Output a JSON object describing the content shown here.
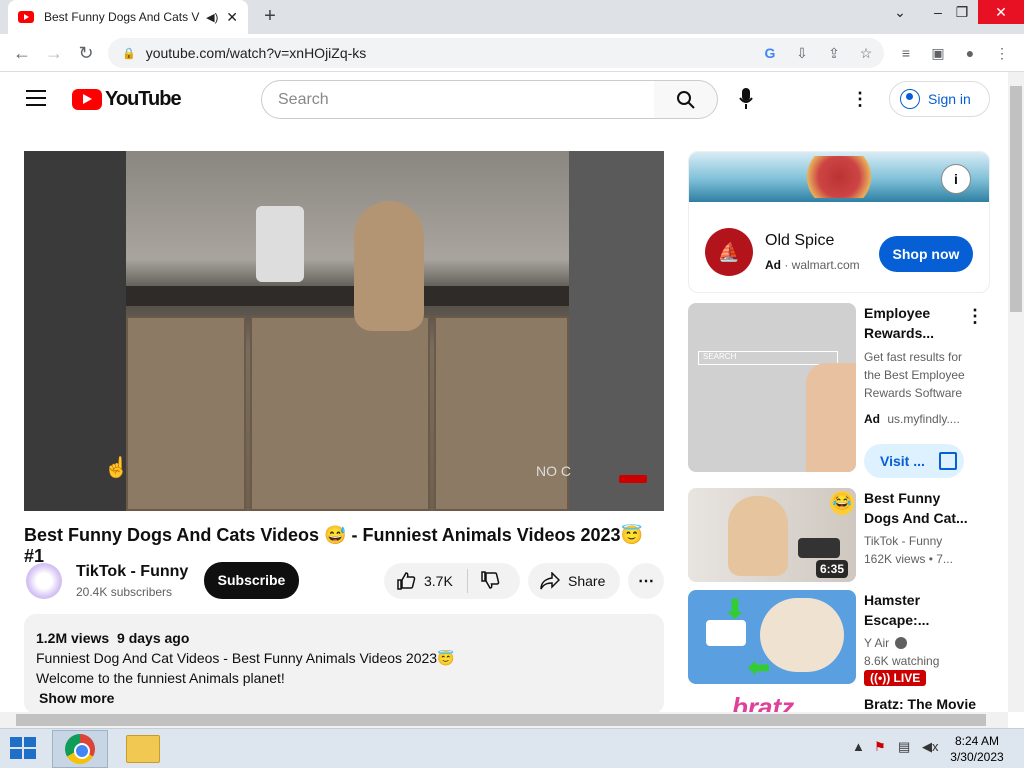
{
  "browser": {
    "tab_title": "Best Funny Dogs And Cats V",
    "new_tab_label": "+",
    "address": "youtube.com/watch?v=xnHOjiZq-ks"
  },
  "youtube": {
    "logo_text": "YouTube",
    "search_placeholder": "Search",
    "signin_label": "Sign in"
  },
  "video": {
    "title": "Best Funny Dogs And Cats Videos 😅 - Funniest Animals Videos 2023😇 #1",
    "watermark": "NO C",
    "channel_name": "TikTok - Funny",
    "subscribers": "20.4K subscribers",
    "subscribe_label": "Subscribe",
    "likes": "3.7K",
    "share_label": "Share",
    "views": "1.2M views",
    "age": "9 days ago",
    "description_line1": "Funniest Dog And Cat Videos - Best Funny Animals Videos 2023😇",
    "description_line2": "Welcome to the funniest Animals planet!",
    "show_more": "Show more"
  },
  "ad": {
    "brand": "Old Spice",
    "ad_label": "Ad",
    "domain": "walmart.com",
    "cta": "Shop now"
  },
  "sidebar": [
    {
      "title_line1": "Employee",
      "title_line2": "Rewards...",
      "desc_line1": "Get fast results for",
      "desc_line2": "the Best Employee",
      "desc_line3": "Rewards Software",
      "ad_label": "Ad",
      "domain": "us.myfindly....",
      "cta": "Visit ...",
      "thumb_search": "SEARCH"
    },
    {
      "title_line1": "Best Funny",
      "title_line2": "Dogs And Cat...",
      "channel": "TikTok - Funny",
      "meta": "162K views  • 7...",
      "duration": "6:35"
    },
    {
      "title_line1": "Hamster",
      "title_line2": "Escape:...",
      "channel": "Y Air",
      "meta": "8.6K watching",
      "badge": "LIVE"
    },
    {
      "title_line1": "Bratz: The Movie",
      "thumb_text": "bratz"
    }
  ],
  "taskbar": {
    "time": "8:24 AM",
    "date": "3/30/2023"
  }
}
